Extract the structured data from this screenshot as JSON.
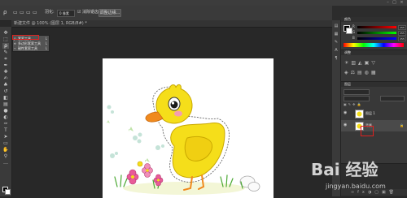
{
  "window": {
    "controls": [
      "–",
      "□",
      "×"
    ]
  },
  "options_bar": {
    "feather_label": "羽化:",
    "feather_value": "0 像素",
    "antialias_label": "消除锯齿",
    "refine_edge_button": "调整边缘..."
  },
  "document": {
    "tab_title": "新建文件 @ 100% (图层 1, RGB/8#) *"
  },
  "tool_flyout": {
    "items": [
      {
        "icon": "lasso-icon",
        "label": "套索工具",
        "key": "L",
        "selected": true
      },
      {
        "icon": "polygonal-lasso-icon",
        "label": "多边形套索工具",
        "key": "L",
        "selected": false
      },
      {
        "icon": "magnetic-lasso-icon",
        "label": "磁性套索工具",
        "key": "L",
        "selected": false
      }
    ]
  },
  "panels": {
    "color": {
      "title": "颜色",
      "sliders": [
        {
          "label": "R",
          "value": "255"
        },
        {
          "label": "G",
          "value": "255"
        },
        {
          "label": "B",
          "value": "255"
        }
      ]
    },
    "adjustments": {
      "title": "调整"
    },
    "layers": {
      "title": "图层",
      "rows": [
        {
          "name": "图层 1",
          "visible": true,
          "locked": false
        },
        {
          "name": "背景",
          "visible": true,
          "locked": true
        }
      ]
    }
  },
  "watermark": {
    "brand": "Bai 经验",
    "url": "jingyan.baidu.com"
  },
  "colors": {
    "highlight_red": "#e0211f",
    "duck_yellow": "#f5de1a",
    "beak_orange": "#f08a1e"
  }
}
